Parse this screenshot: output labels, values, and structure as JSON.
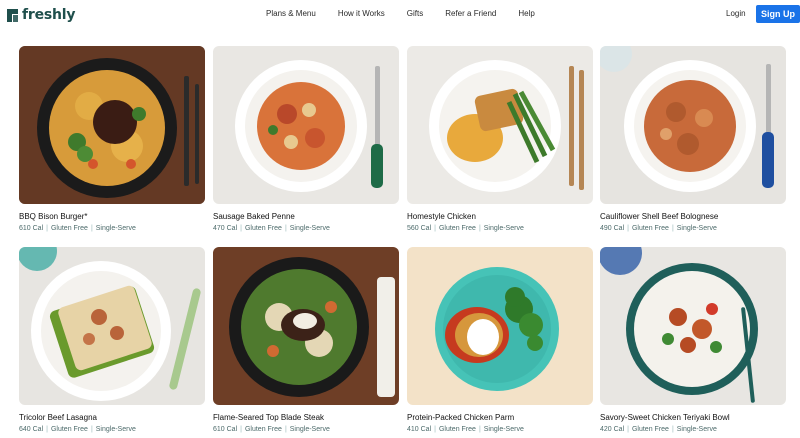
{
  "brand": {
    "name": "freshly",
    "color": "#1f4f4c",
    "accent": "#1a73e8"
  },
  "nav": {
    "links": [
      "Plans & Menu",
      "How it Works",
      "Gifts",
      "Refer a Friend",
      "Help"
    ],
    "login_label": "Login",
    "signup_label": "Sign Up"
  },
  "meals": [
    {
      "name": "BBQ Bison Burger*",
      "calories": "610 Cal",
      "tag1": "Gluten Free",
      "tag2": "Single-Serve"
    },
    {
      "name": "Sausage Baked Penne",
      "calories": "470 Cal",
      "tag1": "Gluten Free",
      "tag2": "Single-Serve"
    },
    {
      "name": "Homestyle Chicken",
      "calories": "560 Cal",
      "tag1": "Gluten Free",
      "tag2": "Single-Serve"
    },
    {
      "name": "Cauliflower Shell Beef Bolognese",
      "calories": "490 Cal",
      "tag1": "Gluten Free",
      "tag2": "Single-Serve"
    },
    {
      "name": "Tricolor Beef Lasagna",
      "calories": "640 Cal",
      "tag1": "Gluten Free",
      "tag2": "Single-Serve"
    },
    {
      "name": "Flame-Seared Top Blade Steak",
      "calories": "610 Cal",
      "tag1": "Gluten Free",
      "tag2": "Single-Serve"
    },
    {
      "name": "Protein-Packed Chicken Parm",
      "calories": "410 Cal",
      "tag1": "Gluten Free",
      "tag2": "Single-Serve"
    },
    {
      "name": "Savory-Sweet Chicken Teriyaki Bowl",
      "calories": "420 Cal",
      "tag1": "Gluten Free",
      "tag2": "Single-Serve"
    }
  ]
}
